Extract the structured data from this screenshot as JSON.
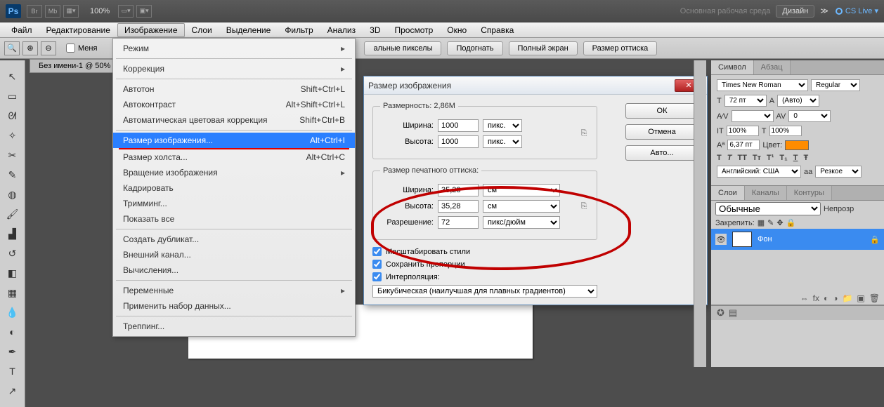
{
  "appbar": {
    "logo": "Ps",
    "btn1": "Br",
    "btn2": "Mb",
    "zoom": "100%",
    "workspace_label": "Основная рабочая среда",
    "design_btn": "Дизайн",
    "arrows": "≫",
    "cslive": "CS Live ▾"
  },
  "menu": {
    "items": [
      "Файл",
      "Редактирование",
      "Изображение",
      "Слои",
      "Выделение",
      "Фильтр",
      "Анализ",
      "3D",
      "Просмотр",
      "Окно",
      "Справка"
    ],
    "active_index": 2
  },
  "optbar": {
    "resize_chk": "Меня",
    "btn_actual": "альные пикселы",
    "btn_fit": "Подогнать",
    "btn_full": "Полный экран",
    "btn_print": "Размер оттиска"
  },
  "doctab": "Без имени-1 @ 50%",
  "dropdown": {
    "items": [
      {
        "label": "Режим",
        "sub": true
      },
      {
        "sep": true
      },
      {
        "label": "Коррекция",
        "sub": true
      },
      {
        "sep": true
      },
      {
        "label": "Автотон",
        "shortcut": "Shift+Ctrl+L"
      },
      {
        "label": "Автоконтраст",
        "shortcut": "Alt+Shift+Ctrl+L"
      },
      {
        "label": "Автоматическая цветовая коррекция",
        "shortcut": "Shift+Ctrl+B"
      },
      {
        "sep": true
      },
      {
        "label": "Размер изображения...",
        "shortcut": "Alt+Ctrl+I",
        "hl": true
      },
      {
        "redline": true
      },
      {
        "label": "Размер холста...",
        "shortcut": "Alt+Ctrl+C"
      },
      {
        "label": "Вращение изображения",
        "sub": true
      },
      {
        "label": "Кадрировать"
      },
      {
        "label": "Тримминг..."
      },
      {
        "label": "Показать все"
      },
      {
        "sep": true
      },
      {
        "label": "Создать дубликат..."
      },
      {
        "label": "Внешний канал..."
      },
      {
        "label": "Вычисления..."
      },
      {
        "sep": true
      },
      {
        "label": "Переменные",
        "sub": true
      },
      {
        "label": "Применить набор данных..."
      },
      {
        "sep": true
      },
      {
        "label": "Треппинг..."
      }
    ]
  },
  "dialog": {
    "title": "Размер изображения",
    "dim_label": "Размерность:",
    "dim_value": "2,86M",
    "width_label": "Ширина:",
    "height_label": "Высота:",
    "px_w": "1000",
    "px_h": "1000",
    "px_unit": "пикс.",
    "print_legend": "Размер печатного оттиска:",
    "print_w": "35,28",
    "print_h": "35,28",
    "cm_unit": "см",
    "res_label": "Разрешение:",
    "res_val": "72",
    "res_unit": "пикс/дюйм",
    "chk_scale": "Масштабировать стили",
    "chk_prop": "Сохранить пропорции",
    "chk_interp": "Интерполяция:",
    "interp_sel": "Бикубическая (наилучшая для плавных градиентов)",
    "ok": "ОК",
    "cancel": "Отмена",
    "auto": "Авто..."
  },
  "right": {
    "tab_symbol": "Символ",
    "tab_para": "Абзац",
    "font": "Times New Roman",
    "style": "Regular",
    "size": "72 пт",
    "leading": "(Авто)",
    "tracking": "0",
    "pct1": "100%",
    "pct2": "100%",
    "baseline": "6,37 пт",
    "color_label": "Цвет:",
    "lang": "Английский: США",
    "aa_label": "aа",
    "aa": "Резкое",
    "tab_layers": "Слои",
    "tab_channels": "Каналы",
    "tab_paths": "Контуры",
    "blend": "Обычные",
    "opacity_label": "Непрозр",
    "lock_label": "Закрепить:",
    "layer_name": "Фон"
  }
}
